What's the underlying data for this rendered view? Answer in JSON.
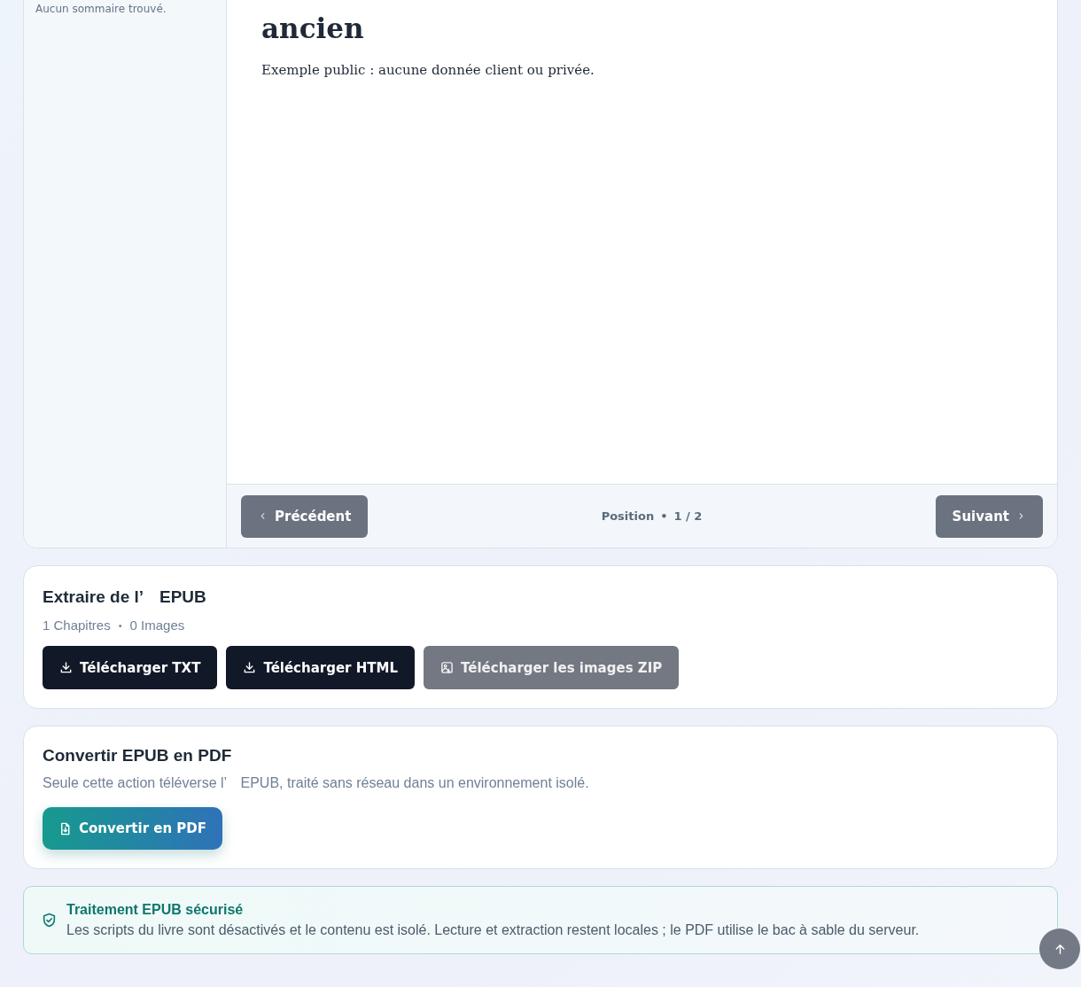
{
  "reader": {
    "sidebar": {
      "empty_text": "Aucun sommaire trouvé."
    },
    "content": {
      "heading": "ancien",
      "paragraph": "Exemple public : aucune donnée client ou privée."
    },
    "nav": {
      "previous": {
        "label": "Précédent"
      },
      "position_label": "Position",
      "separator": "•",
      "position": "1 / 2",
      "next": {
        "label": "Suivant"
      }
    }
  },
  "extract": {
    "title": "Extraire de l’　EPUB",
    "stats": [
      "1 Chapitres",
      "0 Images"
    ],
    "separator": "•",
    "buttons": [
      {
        "label": "Télécharger TXT",
        "kind": "download",
        "disabled": false
      },
      {
        "label": "Télécharger HTML",
        "kind": "download",
        "disabled": false
      },
      {
        "label": "Télécharger les images ZIP",
        "kind": "image",
        "disabled": true
      }
    ]
  },
  "convert": {
    "title": "Convertir EPUB en PDF",
    "description": "Seule cette action téléverse l’　EPUB, traité sans réseau dans un environnement isolé.",
    "button": "Convertir en PDF"
  },
  "notice": {
    "title": "Traitement EPUB sécurisé",
    "text": "Les scripts du livre sont désactivés et le contenu est isolé. Lecture et extraction restent locales ; le PDF utilise le bac à sable du serveur."
  }
}
